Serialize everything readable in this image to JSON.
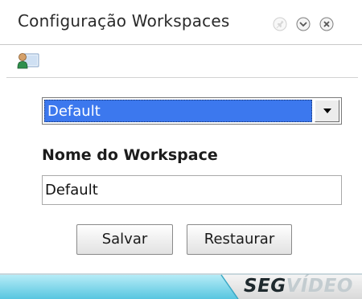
{
  "window": {
    "title": "Configuração Workspaces"
  },
  "titlebar": {
    "buttons": [
      {
        "icon": "pin-icon",
        "state": "disabled"
      },
      {
        "icon": "chevron-down-icon",
        "state": "normal"
      },
      {
        "icon": "close-icon",
        "state": "normal"
      }
    ]
  },
  "toolbar": {
    "icon": "user-icon"
  },
  "workspace_select": {
    "selected": "Default",
    "options": [
      "Default"
    ]
  },
  "workspace_name": {
    "label": "Nome do Workspace",
    "value": "Default"
  },
  "actions": {
    "save_label": "Salvar",
    "restore_label": "Restaurar"
  },
  "footer": {
    "brand_part1": "SEG",
    "brand_part2": "VÍDEO"
  },
  "colors": {
    "selection": "#3c78ee",
    "footer_band": "#7fd6ea",
    "brand_dark": "#1f2a2e",
    "brand_light": "#c3ccd0"
  }
}
